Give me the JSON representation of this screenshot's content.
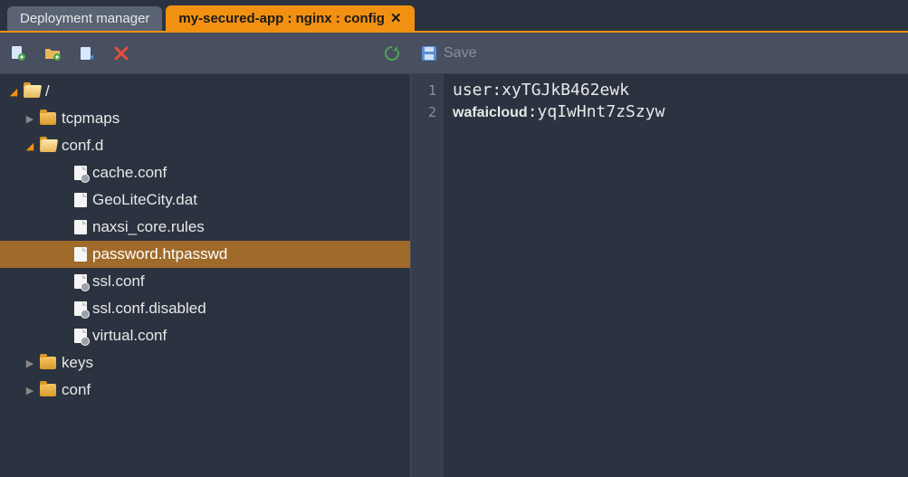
{
  "tabs": {
    "inactive": "Deployment manager",
    "active": "my-secured-app : nginx : config"
  },
  "toolbar": {
    "save_label": "Save"
  },
  "tree": {
    "root": "/",
    "tcpmaps": "tcpmaps",
    "confd": "conf.d",
    "cache": "cache.conf",
    "geolite": "GeoLiteCity.dat",
    "naxsi": "naxsi_core.rules",
    "passwd": "password.htpasswd",
    "ssl": "ssl.conf",
    "ssldis": "ssl.conf.disabled",
    "virtual": "virtual.conf",
    "keys": "keys",
    "conf": "conf"
  },
  "editor": {
    "gutter": [
      "1",
      "2"
    ],
    "line1": "user:xyTGJkB462ewk",
    "line2_user": "wafaicloud",
    "line2_rest": ":yqIwHnt7zSzyw"
  }
}
